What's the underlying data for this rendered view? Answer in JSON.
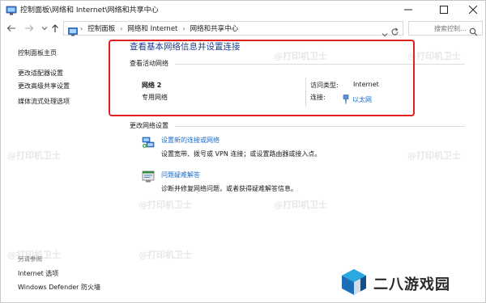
{
  "window": {
    "title": "控制面板\\网络和 Internet\\网络和共享中心"
  },
  "address": {
    "crumbs": [
      "控制面板",
      "网络和 Internet",
      "网络和共享中心"
    ],
    "search_placeholder": "搜索控制..."
  },
  "sidebar": {
    "items": [
      {
        "label": "控制面板主页"
      },
      {
        "label": "更改适配器设置"
      },
      {
        "label": "更改高级共享设置"
      },
      {
        "label": "媒体流式处理选项"
      }
    ],
    "see_also_label": "另请参阅",
    "see_also": [
      {
        "label": "Internet 选项"
      },
      {
        "label": "Windows Defender 防火墙"
      }
    ]
  },
  "main": {
    "title": "查看基本网络信息并设置连接",
    "active_networks_label": "查看活动网络",
    "network": {
      "name": "网络 2",
      "profile": "专用网络",
      "access_type_label": "访问类型:",
      "access_type_value": "Internet",
      "connections_label": "连接:",
      "connection_value": "以太网"
    },
    "change_settings_label": "更改网络设置",
    "tasks": [
      {
        "link": "设置新的连接或网络",
        "desc": "设置宽带、拨号或 VPN 连接；或设置路由器或接入点。",
        "icon": "network-setup-icon"
      },
      {
        "link": "问题疑难解答",
        "desc": "诊断并修复网络问题，或者获得疑难解答信息。",
        "icon": "troubleshoot-icon"
      }
    ]
  },
  "watermark": "@打印机卫士",
  "brand": {
    "name": "二八游戏园"
  },
  "colors": {
    "link": "#1a6ac9",
    "title": "#1e3f8a",
    "highlight": "#e02020"
  }
}
